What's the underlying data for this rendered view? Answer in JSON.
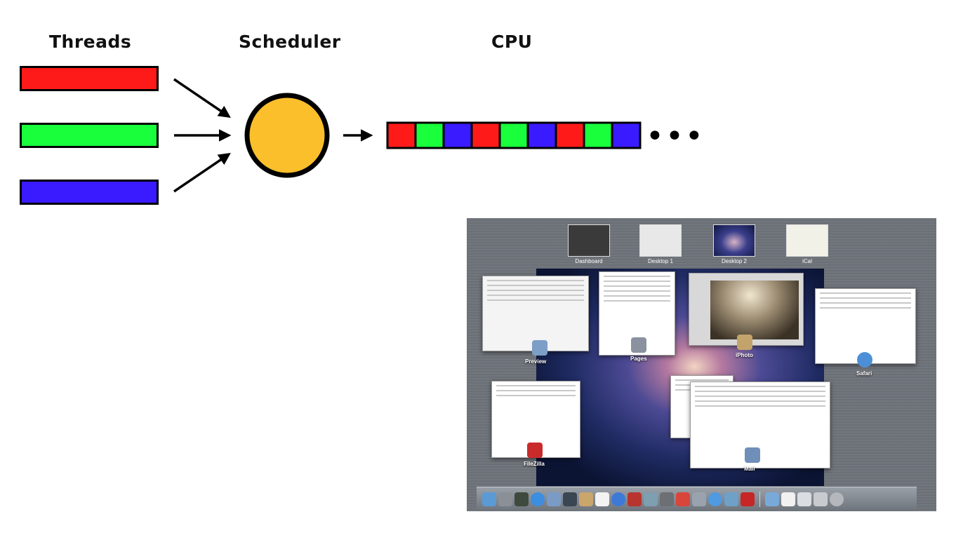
{
  "diagram": {
    "headings": {
      "threads": "Threads",
      "scheduler": "Scheduler",
      "cpu": "CPU"
    },
    "threads": [
      {
        "name": "thread-red",
        "color": "#ff1a1a"
      },
      {
        "name": "thread-green",
        "color": "#19ff3c"
      },
      {
        "name": "thread-blue",
        "color": "#3a1aff"
      }
    ],
    "scheduler_color": "#fbbf2b",
    "cpu_slices": [
      "#ff1a1a",
      "#19ff3c",
      "#3a1aff",
      "#ff1a1a",
      "#19ff3c",
      "#3a1aff",
      "#ff1a1a",
      "#19ff3c",
      "#3a1aff"
    ],
    "continuation": "•••"
  },
  "mission_control": {
    "spaces": [
      "Dashboard",
      "Desktop 1",
      "Desktop 2",
      "iCal"
    ],
    "apps": [
      "Preview",
      "Pages",
      "iPhoto",
      "Safari",
      "FileZilla",
      "Mail"
    ]
  }
}
